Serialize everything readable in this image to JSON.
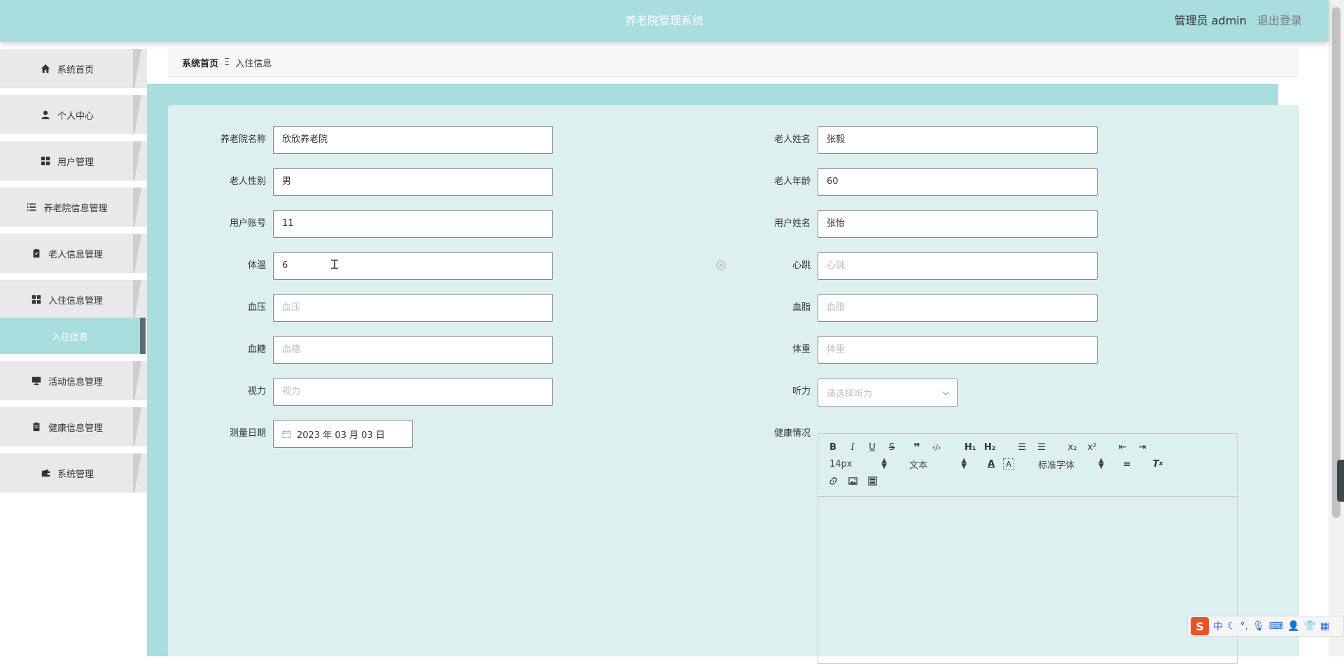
{
  "header": {
    "title": "养老院管理系统",
    "admin_label": "管理员 admin",
    "logout_label": "退出登录"
  },
  "sidebar": {
    "items": [
      {
        "label": "系统首页",
        "icon": "home-icon"
      },
      {
        "label": "个人中心",
        "icon": "user-icon"
      },
      {
        "label": "用户管理",
        "icon": "grid-icon"
      },
      {
        "label": "养老院信息管理",
        "icon": "list-icon"
      },
      {
        "label": "老人信息管理",
        "icon": "clipboard-icon"
      },
      {
        "label": "入住信息管理",
        "icon": "grid-icon"
      },
      {
        "label": "入住信息",
        "icon": ""
      },
      {
        "label": "活动信息管理",
        "icon": "monitor-icon"
      },
      {
        "label": "健康信息管理",
        "icon": "clipboard-icon"
      },
      {
        "label": "系统管理",
        "icon": "wallet-icon"
      }
    ],
    "active_index": 6
  },
  "breadcrumb": {
    "home": "系统首页",
    "separator": "Ξ",
    "current": "入住信息"
  },
  "form": {
    "nursing_home_name": {
      "label": "养老院名称",
      "value": "欣欣养老院"
    },
    "elder_name": {
      "label": "老人姓名",
      "value": "张毅"
    },
    "elder_gender": {
      "label": "老人性别",
      "value": "男"
    },
    "elder_age": {
      "label": "老人年龄",
      "value": "60"
    },
    "user_account": {
      "label": "用户账号",
      "value": "11"
    },
    "user_name": {
      "label": "用户姓名",
      "value": "张怡"
    },
    "temperature": {
      "label": "体温",
      "value": "6"
    },
    "heartbeat": {
      "label": "心跳",
      "placeholder": "心跳"
    },
    "blood_pressure": {
      "label": "血压",
      "placeholder": "血压"
    },
    "blood_lipid": {
      "label": "血脂",
      "placeholder": "血脂"
    },
    "blood_sugar": {
      "label": "血糖",
      "placeholder": "血糖"
    },
    "weight": {
      "label": "体重",
      "placeholder": "体重"
    },
    "vision": {
      "label": "视力",
      "placeholder": "视力"
    },
    "hearing": {
      "label": "听力",
      "placeholder": "请选择听力"
    },
    "measure_date": {
      "label": "测量日期",
      "value": "2023 年 03 月 03 日"
    },
    "health": {
      "label": "健康情况"
    }
  },
  "editor": {
    "font_size": "14px",
    "text_type": "文本",
    "font_family": "标准字体"
  },
  "ime": {
    "logo": "S",
    "lang": "中"
  }
}
